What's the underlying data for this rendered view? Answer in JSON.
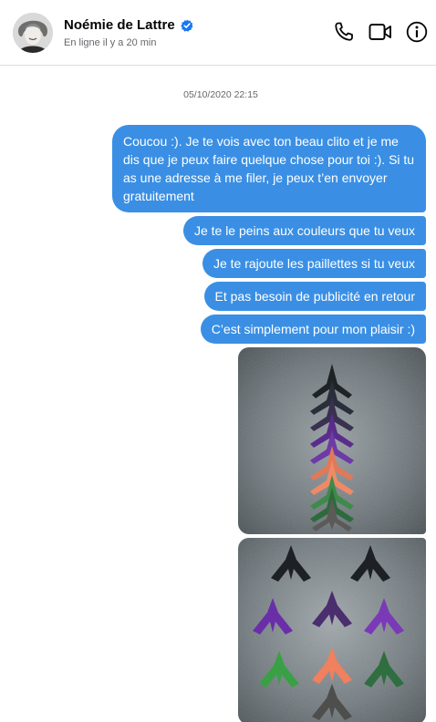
{
  "header": {
    "contact_name": "Noémie de Lattre",
    "status": "En ligne il y a 20 min",
    "icons": [
      "phone-icon",
      "video-icon",
      "info-icon"
    ],
    "verified_badge": "verified-icon"
  },
  "conversation": {
    "timestamp": "05/10/2020 22:15",
    "messages": [
      {
        "text": "Coucou :). Je te vois avec ton beau clito et je me dis que je peux faire quelque chose pour toi :). Si tu as une adresse à me filer, je peux t’en envoyer gratuitement"
      },
      {
        "text": "Je te le peins aux couleurs que tu veux"
      },
      {
        "text": "Je te rajoute les paillettes si tu veux"
      },
      {
        "text": "Et pas besoin de publicité en retour"
      },
      {
        "text": "C’est simplement pour mon plaisir :)"
      }
    ],
    "photos": [
      {
        "description": "photo-glitter-clitoris-models-column"
      },
      {
        "description": "photo-glitter-clitoris-models-grid"
      }
    ]
  },
  "colors": {
    "bubble": "#3a8fe4",
    "bubble_text": "#ffffff",
    "verified": "#1877f2",
    "muted_text": "#65676b"
  }
}
